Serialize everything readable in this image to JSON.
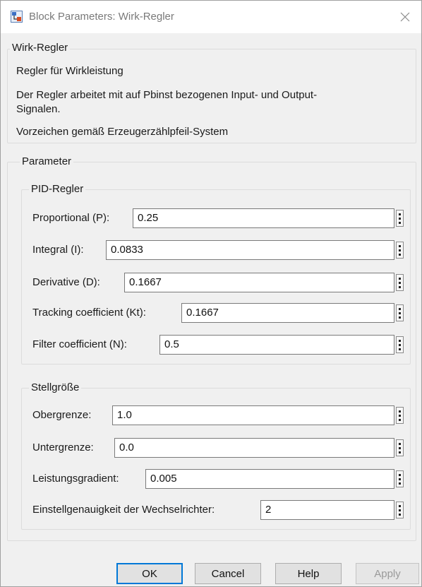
{
  "window": {
    "title": "Block Parameters: Wirk-Regler",
    "close_icon": "close-icon"
  },
  "description": {
    "legend": "Wirk-Regler",
    "line1": "Regler für Wirkleistung",
    "line2a": "Der Regler arbeitet mit auf Pbinst bezogenen Input- und Output-",
    "line2b": "Signalen.",
    "line3": "Vorzeichen gemäß Erzeugerzählpfeil-System"
  },
  "parameter": {
    "legend": "Parameter",
    "pid": {
      "legend": "PID-Regler",
      "fields": [
        {
          "label": "Proportional (P):",
          "value": "0.25"
        },
        {
          "label": "Integral (I):",
          "value": "0.0833"
        },
        {
          "label": "Derivative (D):",
          "value": "0.1667"
        },
        {
          "label": "Tracking coefficient (Kt):",
          "value": "0.1667"
        },
        {
          "label": "Filter coefficient (N):",
          "value": "0.5"
        }
      ]
    },
    "stell": {
      "legend": "Stellgröße",
      "fields": [
        {
          "label": "Obergrenze:",
          "value": "1.0"
        },
        {
          "label": "Untergrenze:",
          "value": "0.0"
        },
        {
          "label": "Leistungsgradient:",
          "value": "0.005"
        },
        {
          "label": "Einstellgenauigkeit der Wechselrichter:",
          "value": "2"
        }
      ]
    }
  },
  "buttons": {
    "ok": "OK",
    "cancel": "Cancel",
    "help": "Help",
    "apply": "Apply"
  }
}
